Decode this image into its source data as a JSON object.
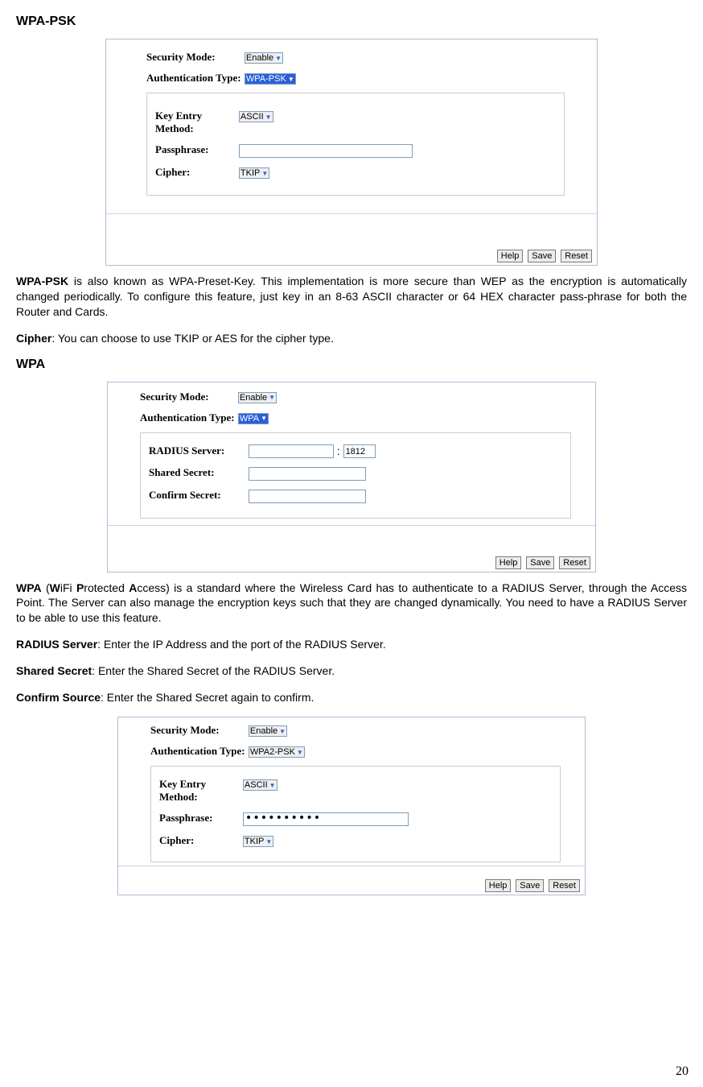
{
  "headings": {
    "wpa_psk": "WPA-PSK",
    "wpa": "WPA"
  },
  "panel1": {
    "fields": {
      "sec": "Security Mode:",
      "auth": "Authentication Type:",
      "key": "Key Entry Method:",
      "pass": "Passphrase:",
      "cipher": "Cipher:"
    },
    "values": {
      "sec": "Enable",
      "auth": "WPA-PSK",
      "key": "ASCII",
      "cipher": "TKIP"
    },
    "buttons": {
      "help": "Help",
      "save": "Save",
      "reset": "Reset"
    }
  },
  "para1": {
    "lead": "WPA-PSK",
    "body": " is also known as WPA-Preset-Key. This implementation is more secure than WEP as the encryption is automatically changed periodically. To configure this feature, just key in an 8-63 ASCII character or 64 HEX character pass-phrase for both the Router and Cards."
  },
  "para_cipher": {
    "lead": "Cipher",
    "body": ": You can choose to use TKIP or AES for the cipher type."
  },
  "panel2": {
    "fields": {
      "sec": "Security Mode:",
      "auth": "Authentication Type:",
      "radius": "RADIUS Server:",
      "shared": "Shared Secret:",
      "confirm": "Confirm Secret:"
    },
    "values": {
      "sec": "Enable",
      "auth": "WPA",
      "port": "1812"
    },
    "buttons": {
      "help": "Help",
      "save": "Save",
      "reset": "Reset"
    }
  },
  "para_wpa": {
    "lead": "WPA",
    "body": "iFi ",
    "body2": "rotected ",
    "body3": "ccess) is a standard where the Wireless Card has to authenticate to a RADIUS Server, through the Access Point. The Server can also manage the encryption keys such that they are changed dynamically. You need to have a RADIUS Server to be able to use this feature.",
    "w": "W",
    "p": "P",
    "a": "A",
    "opar": " ("
  },
  "para_radius": {
    "lead": "RADIUS Server",
    "body": ": Enter the IP Address and the port of the RADIUS Server."
  },
  "para_shared": {
    "lead": "Shared Secret",
    "body": ": Enter the Shared Secret of the RADIUS Server."
  },
  "para_confirm": {
    "lead": "Confirm Source",
    "body": ": Enter the Shared Secret again to confirm."
  },
  "panel3": {
    "fields": {
      "sec": "Security Mode:",
      "auth": "Authentication Type:",
      "key": "Key Entry Method:",
      "pass": "Passphrase:",
      "cipher": "Cipher:"
    },
    "values": {
      "sec": "Enable",
      "auth": "WPA2-PSK",
      "key": "ASCII",
      "pass": "••••••••••",
      "cipher": "TKIP"
    },
    "buttons": {
      "help": "Help",
      "save": "Save",
      "reset": "Reset"
    }
  },
  "page": "20"
}
